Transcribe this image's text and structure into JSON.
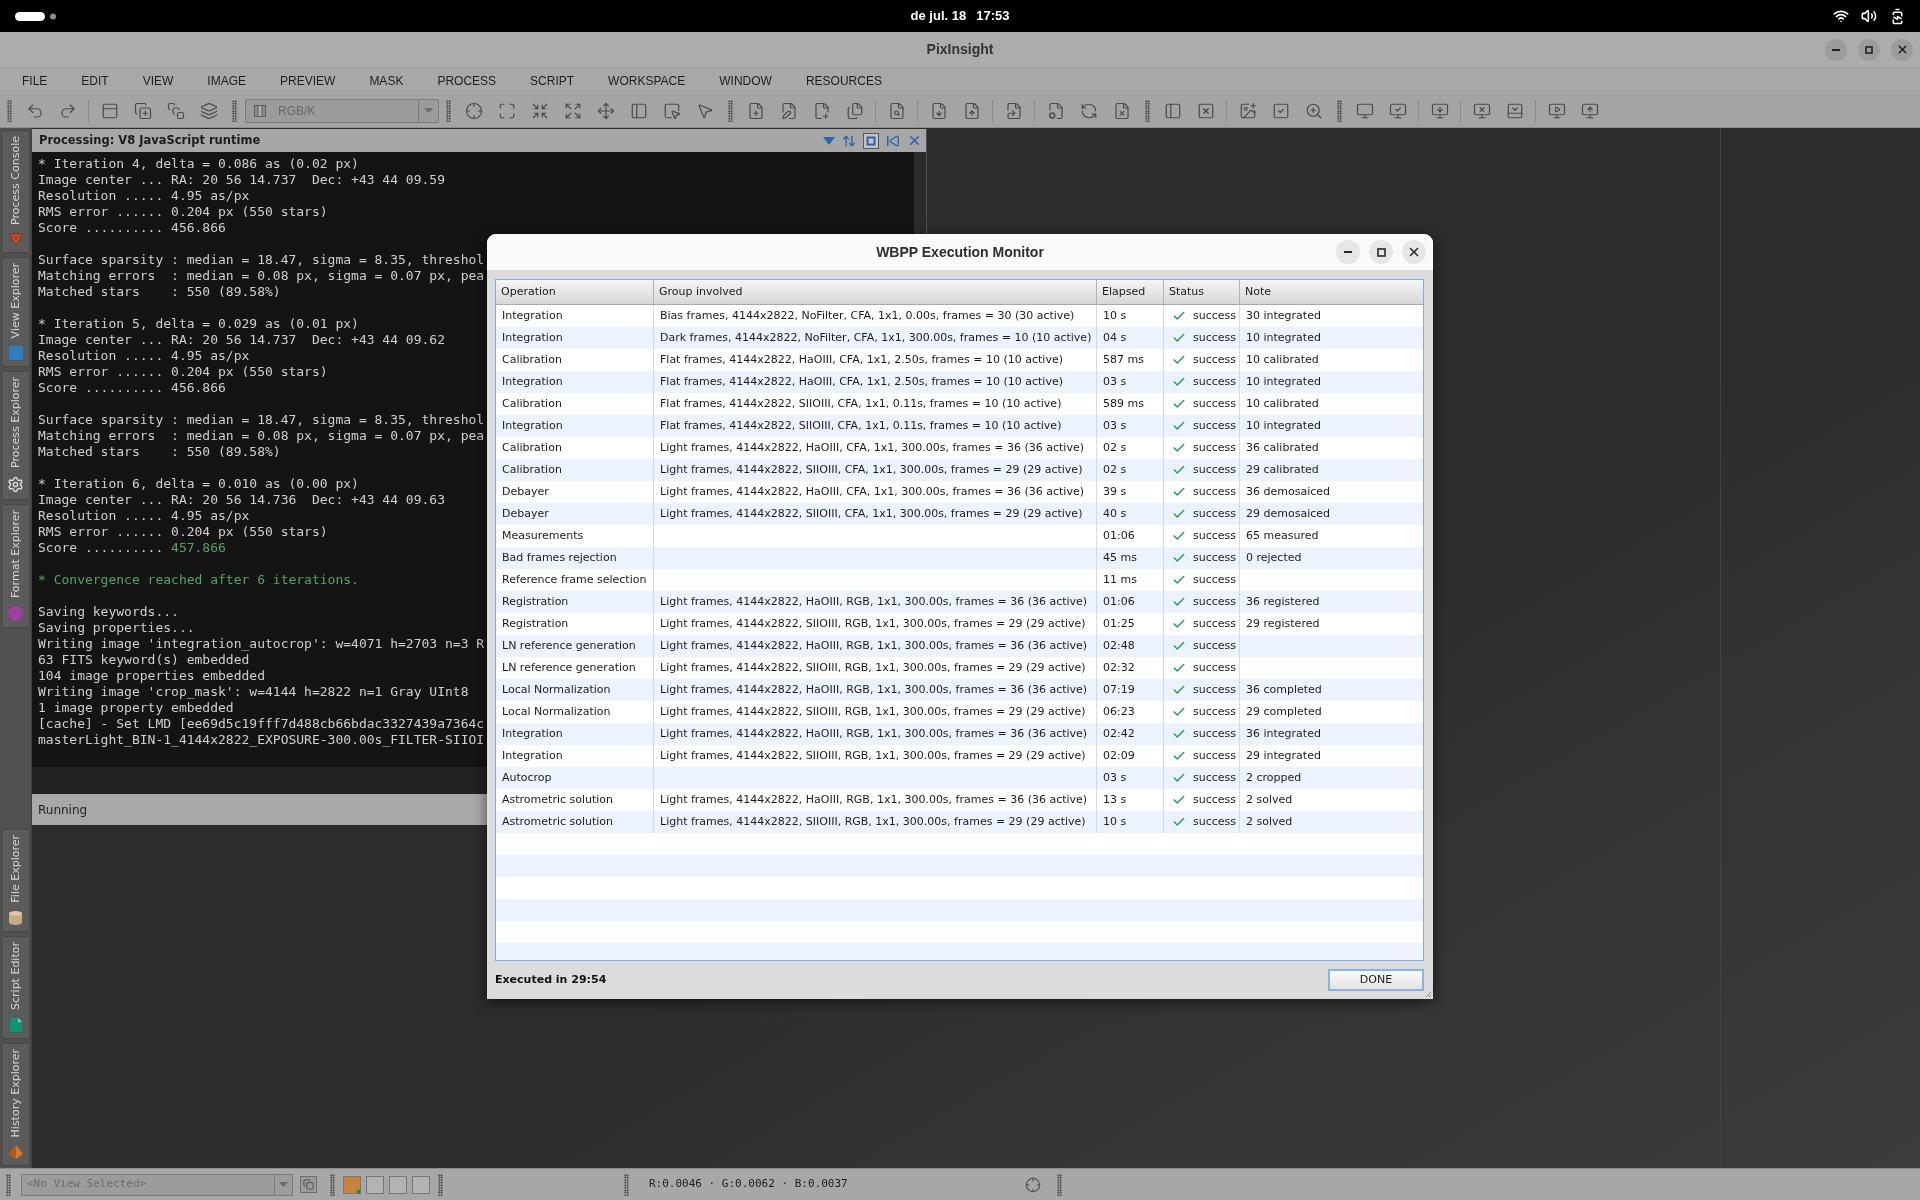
{
  "system_bar": {
    "date": "de jul. 18",
    "time": "17:53"
  },
  "window": {
    "title": "PixInsight"
  },
  "menu": [
    "FILE",
    "EDIT",
    "VIEW",
    "IMAGE",
    "PREVIEW",
    "MASK",
    "PROCESS",
    "SCRIPT",
    "WORKSPACE",
    "WINDOW",
    "RESOURCES"
  ],
  "toolbar": {
    "color_space": {
      "value": "RGB/K",
      "disabled": true
    }
  },
  "sidebar": {
    "top_tabs": [
      "Process Console",
      "View Explorer",
      "Process Explorer",
      "Format Explorer"
    ],
    "bottom_tabs": [
      "File Explorer",
      "Script Editor",
      "History Explorer"
    ]
  },
  "console": {
    "title": "Processing: V8 JavaScript runtime",
    "blocks": [
      [
        [
          {
            "text": "* Iteration 4, delta = 0.086 as (0.02 px)",
            "kind": "plain"
          }
        ],
        [
          {
            "text": "Image center ... RA: 20 56 14.737  Dec: +43 44 09.59",
            "kind": "plain"
          }
        ],
        [
          {
            "text": "Resolution ..... 4.95 as/px",
            "kind": "plain"
          }
        ],
        [
          {
            "text": "RMS error ...... 0.204 px (550 stars)",
            "kind": "plain"
          }
        ],
        [
          {
            "text": "Score .......... 456.866",
            "kind": "plain"
          }
        ]
      ],
      [
        [
          {
            "text": "Surface sparsity : median = 18.47, sigma = 8.35, threshol",
            "kind": "plain"
          }
        ],
        [
          {
            "text": "Matching errors  : median = 0.08 px, sigma = 0.07 px, pea",
            "kind": "plain"
          }
        ],
        [
          {
            "text": "Matched stars    : 550 (89.58%)",
            "kind": "plain"
          }
        ]
      ],
      [
        [
          {
            "text": "* Iteration 5, delta = 0.029 as (0.01 px)",
            "kind": "plain"
          }
        ],
        [
          {
            "text": "Image center ... RA: 20 56 14.737  Dec: +43 44 09.62",
            "kind": "plain"
          }
        ],
        [
          {
            "text": "Resolution ..... 4.95 as/px",
            "kind": "plain"
          }
        ],
        [
          {
            "text": "RMS error ...... 0.204 px (550 stars)",
            "kind": "plain"
          }
        ],
        [
          {
            "text": "Score .......... 456.866",
            "kind": "plain"
          }
        ]
      ],
      [
        [
          {
            "text": "Surface sparsity : median = 18.47, sigma = 8.35, threshol",
            "kind": "plain"
          }
        ],
        [
          {
            "text": "Matching errors  : median = 0.08 px, sigma = 0.07 px, pea",
            "kind": "plain"
          }
        ],
        [
          {
            "text": "Matched stars    : 550 (89.58%)",
            "kind": "plain"
          }
        ]
      ],
      [
        [
          {
            "text": "* Iteration 6, delta = 0.010 as (0.00 px)",
            "kind": "plain"
          }
        ],
        [
          {
            "text": "Image center ... RA: 20 56 14.736  Dec: +43 44 09.63",
            "kind": "plain"
          }
        ],
        [
          {
            "text": "Resolution ..... 4.95 as/px",
            "kind": "plain"
          }
        ],
        [
          {
            "text": "RMS error ...... 0.204 px (550 stars)",
            "kind": "plain"
          }
        ],
        [
          {
            "text": "Score .......... ",
            "kind": "plain"
          },
          {
            "text": "457.866",
            "kind": "success"
          }
        ]
      ],
      [
        [
          {
            "text": "* Convergence reached after 6 iterations.",
            "kind": "success"
          }
        ]
      ],
      [
        [
          {
            "text": "Saving keywords...",
            "kind": "plain"
          }
        ],
        [
          {
            "text": "Saving properties...",
            "kind": "plain"
          }
        ],
        [
          {
            "text": "Writing image 'integration_autocrop': w=4071 h=2703 n=3 R",
            "kind": "plain"
          }
        ],
        [
          {
            "text": "63 FITS keyword(s) embedded",
            "kind": "plain"
          }
        ],
        [
          {
            "text": "104 image properties embedded",
            "kind": "plain"
          }
        ],
        [
          {
            "text": "Writing image 'crop_mask': w=4144 h=2822 n=1 Gray UInt8",
            "kind": "plain"
          }
        ],
        [
          {
            "text": "1 image property embedded",
            "kind": "plain"
          }
        ],
        [
          {
            "text": "[cache] - Set LMD [ee69d5c19fff7d488cb66bdac3327439a7364c",
            "kind": "plain"
          }
        ],
        [
          {
            "text": "masterLight_BIN-1_4144x2822_EXPOSURE-300.00s_FILTER-SIIOI",
            "kind": "plain"
          }
        ]
      ]
    ],
    "status": "Running"
  },
  "dialog": {
    "title": "WBPP Execution Monitor",
    "columns": [
      "Operation",
      "Group involved",
      "Elapsed",
      "Status",
      "Note"
    ],
    "rows": [
      {
        "operation": "Integration",
        "group": "Bias frames, 4144x2822, NoFilter, CFA, 1x1, 0.00s, frames = 30 (30 active)",
        "elapsed": "10 s",
        "succeeded": true,
        "status": "success",
        "note": "30 integrated"
      },
      {
        "operation": "Integration",
        "group": "Dark frames, 4144x2822, NoFilter, CFA, 1x1, 300.00s, frames = 10 (10 active)",
        "elapsed": "04 s",
        "succeeded": true,
        "status": "success",
        "note": "10 integrated"
      },
      {
        "operation": "Calibration",
        "group": "Flat frames, 4144x2822, HaOIII, CFA, 1x1, 2.50s, frames = 10 (10 active)",
        "elapsed": "587 ms",
        "succeeded": true,
        "status": "success",
        "note": "10 calibrated"
      },
      {
        "operation": "Integration",
        "group": "Flat frames, 4144x2822, HaOIII, CFA, 1x1, 2.50s, frames = 10 (10 active)",
        "elapsed": "03 s",
        "succeeded": true,
        "status": "success",
        "note": "10 integrated"
      },
      {
        "operation": "Calibration",
        "group": "Flat frames, 4144x2822, SIIOIII, CFA, 1x1, 0.11s, frames = 10 (10 active)",
        "elapsed": "589 ms",
        "succeeded": true,
        "status": "success",
        "note": "10 calibrated"
      },
      {
        "operation": "Integration",
        "group": "Flat frames, 4144x2822, SIIOIII, CFA, 1x1, 0.11s, frames = 10 (10 active)",
        "elapsed": "03 s",
        "succeeded": true,
        "status": "success",
        "note": "10 integrated"
      },
      {
        "operation": "Calibration",
        "group": "Light frames, 4144x2822, HaOIII, CFA, 1x1, 300.00s, frames = 36 (36 active)",
        "elapsed": "02 s",
        "succeeded": true,
        "status": "success",
        "note": "36 calibrated"
      },
      {
        "operation": "Calibration",
        "group": "Light frames, 4144x2822, SIIOIII, CFA, 1x1, 300.00s, frames = 29 (29 active)",
        "elapsed": "02 s",
        "succeeded": true,
        "status": "success",
        "note": "29 calibrated"
      },
      {
        "operation": "Debayer",
        "group": "Light frames, 4144x2822, HaOIII, CFA, 1x1, 300.00s, frames = 36 (36 active)",
        "elapsed": "39 s",
        "succeeded": true,
        "status": "success",
        "note": "36 demosaiced"
      },
      {
        "operation": "Debayer",
        "group": "Light frames, 4144x2822, SIIOIII, CFA, 1x1, 300.00s, frames = 29 (29 active)",
        "elapsed": "40 s",
        "succeeded": true,
        "status": "success",
        "note": "29 demosaiced"
      },
      {
        "operation": "Measurements",
        "elapsed": "01:06",
        "succeeded": true,
        "status": "success",
        "note": "65 measured"
      },
      {
        "operation": "Bad frames rejection",
        "elapsed": "45 ms",
        "succeeded": true,
        "status": "success",
        "note": "0 rejected"
      },
      {
        "operation": "Reference frame selection",
        "elapsed": "11 ms",
        "succeeded": true,
        "status": "success"
      },
      {
        "operation": "Registration",
        "group": "Light frames, 4144x2822, HaOIII, RGB, 1x1, 300.00s, frames = 36 (36 active)",
        "elapsed": "01:06",
        "succeeded": true,
        "status": "success",
        "note": "36 registered"
      },
      {
        "operation": "Registration",
        "group": "Light frames, 4144x2822, SIIOIII, RGB, 1x1, 300.00s, frames = 29 (29 active)",
        "elapsed": "01:25",
        "succeeded": true,
        "status": "success",
        "note": "29 registered"
      },
      {
        "operation": "LN reference generation",
        "group": "Light frames, 4144x2822, HaOIII, RGB, 1x1, 300.00s, frames = 36 (36 active)",
        "elapsed": "02:48",
        "succeeded": true,
        "status": "success"
      },
      {
        "operation": "LN reference generation",
        "group": "Light frames, 4144x2822, SIIOIII, RGB, 1x1, 300.00s, frames = 29 (29 active)",
        "elapsed": "02:32",
        "succeeded": true,
        "status": "success"
      },
      {
        "operation": "Local Normalization",
        "group": "Light frames, 4144x2822, HaOIII, RGB, 1x1, 300.00s, frames = 36 (36 active)",
        "elapsed": "07:19",
        "succeeded": true,
        "status": "success",
        "note": "36 completed"
      },
      {
        "operation": "Local Normalization",
        "group": "Light frames, 4144x2822, SIIOIII, RGB, 1x1, 300.00s, frames = 29 (29 active)",
        "elapsed": "06:23",
        "succeeded": true,
        "status": "success",
        "note": "29 completed"
      },
      {
        "operation": "Integration",
        "group": "Light frames, 4144x2822, HaOIII, RGB, 1x1, 300.00s, frames = 36 (36 active)",
        "elapsed": "02:42",
        "succeeded": true,
        "status": "success",
        "note": "36 integrated"
      },
      {
        "operation": "Integration",
        "group": "Light frames, 4144x2822, SIIOIII, RGB, 1x1, 300.00s, frames = 29 (29 active)",
        "elapsed": "02:09",
        "succeeded": true,
        "status": "success",
        "note": "29 integrated"
      },
      {
        "operation": "Autocrop",
        "elapsed": "03 s",
        "succeeded": true,
        "status": "success",
        "note": "2 cropped"
      },
      {
        "operation": "Astrometric solution",
        "group": "Light frames, 4144x2822, HaOIII, RGB, 1x1, 300.00s, frames = 36 (36 active)",
        "elapsed": "13 s",
        "succeeded": true,
        "status": "success",
        "note": "2 solved"
      },
      {
        "operation": "Astrometric solution",
        "group": "Light frames, 4144x2822, SIIOIII, RGB, 1x1, 300.00s, frames = 29 (29 active)",
        "elapsed": "10 s",
        "succeeded": true,
        "status": "success",
        "note": "2 solved"
      }
    ],
    "footer": "Executed in 29:54",
    "done_button": "DONE"
  },
  "status_bar": {
    "view_selector": {
      "value": "<No View Selected>",
      "disabled": true
    },
    "readout": "R:0.0046 · G:0.0062 · B:0.0037"
  }
}
